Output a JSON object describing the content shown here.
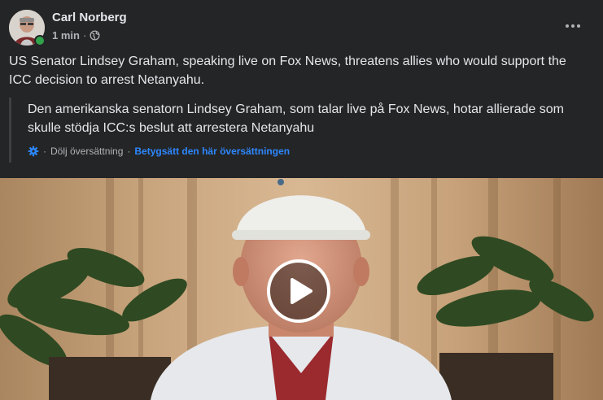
{
  "post": {
    "author": "Carl Norberg",
    "time": "1 min",
    "separator": "·",
    "audience_icon": "globe-icon",
    "text": "US Senator Lindsey Graham, speaking live on Fox News, threatens allies who would support the ICC decision to arrest Netanyahu.",
    "translation": {
      "text": "Den amerikanska senatorn Lindsey Graham, som talar live på Fox News, hotar allierade som skulle stödja ICC:s beslut att arrestera Netanyahu",
      "settings_icon": "gear-icon",
      "separator": "·",
      "hide_label": "Dölj översättning",
      "rate_label": "Betygsätt den här översättningen"
    },
    "video": {
      "play_icon": "play-icon"
    }
  },
  "colors": {
    "card_bg": "#242526",
    "text_primary": "#e4e6eb",
    "text_secondary": "#b0b3b8",
    "link_blue": "#2d88ff",
    "online_green": "#31a24c"
  }
}
